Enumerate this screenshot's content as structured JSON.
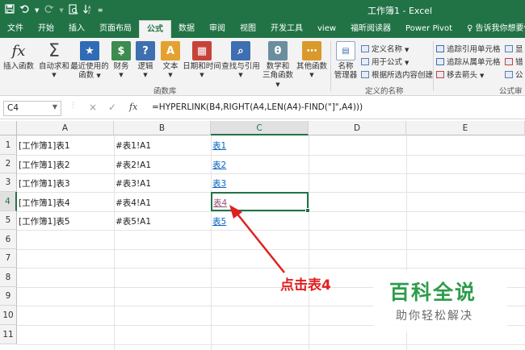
{
  "window": {
    "title": "工作簿1 - Excel"
  },
  "quick_access": {
    "save_icon": "save-icon",
    "undo_icon": "undo-icon",
    "redo_icon": "redo-icon",
    "print_preview_icon": "print-preview-icon",
    "sort_icon": "sort-icon"
  },
  "tabs": [
    "文件",
    "开始",
    "插入",
    "页面布局",
    "公式",
    "数据",
    "审阅",
    "视图",
    "开发工具",
    "view",
    "福昕阅读器",
    "Power Pivot",
    "♀ 告诉我你想要做什"
  ],
  "active_tab": "公式",
  "ribbon": {
    "function_library": {
      "label": "函数库",
      "insert_function": "插入函数",
      "autosum": "自动求和",
      "recent_1": "最近使用的",
      "recent_2": "函数",
      "financial": "财务",
      "logical": "逻辑",
      "text": "文本",
      "datetime": "日期和时间",
      "lookup": "查找与引用",
      "math_1": "数学和",
      "math_2": "三角函数",
      "more": "其他函数"
    },
    "defined_names": {
      "label": "定义的名称",
      "name_manager_1": "名称",
      "name_manager_2": "管理器",
      "define_name": "定义名称",
      "use_in_formula": "用于公式",
      "create_from_selection": "根据所选内容创建"
    },
    "formula_auditing": {
      "label": "公式审核",
      "trace_precedents": "追踪引用单元格",
      "trace_dependents": "追踪从属单元格",
      "remove_arrows": "移去箭头",
      "show_formulas": "显",
      "error_checking": "错",
      "evaluate": "公"
    }
  },
  "formula_bar": {
    "name_box": "C4",
    "cancel": "×",
    "enter": "✓",
    "fx": "fx",
    "formula": "=HYPERLINK(B4,RIGHT(A4,LEN(A4)-FIND(\"]\",A4)))"
  },
  "grid": {
    "columns": [
      "A",
      "B",
      "C",
      "D",
      "E"
    ],
    "selected_column": "C",
    "rows": [
      "1",
      "2",
      "3",
      "4",
      "5",
      "6",
      "7",
      "8",
      "9",
      "10",
      "11"
    ],
    "selected_row": "4",
    "cells": [
      {
        "a": "[工作簿1]表1",
        "b": "#表1!A1",
        "c": "表1"
      },
      {
        "a": "[工作簿1]表2",
        "b": "#表2!A1",
        "c": "表2"
      },
      {
        "a": "[工作簿1]表3",
        "b": "#表3!A1",
        "c": "表3"
      },
      {
        "a": "[工作簿1]表4",
        "b": "#表4!A1",
        "c": "表4"
      },
      {
        "a": "[工作簿1]表5",
        "b": "#表5!A1",
        "c": "表5"
      }
    ]
  },
  "annotation": {
    "text": "点击表4",
    "color": "#e02020"
  },
  "watermark": {
    "title": "百科全说",
    "subtitle": "助你轻松解决"
  },
  "colors": {
    "excel_green": "#217346",
    "link": "#0563c1",
    "visited_link": "#954f72"
  }
}
